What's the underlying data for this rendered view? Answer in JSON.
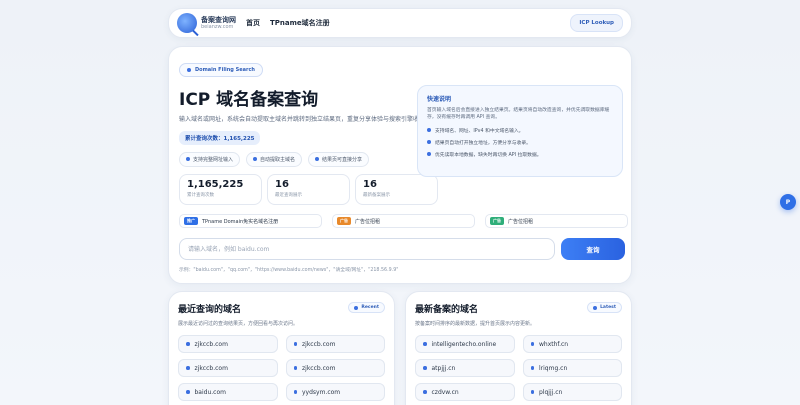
{
  "header": {
    "logo_name": "备案查询网",
    "logo_domain": "beianzw.com",
    "nav": [
      "首页",
      "TPname域名注册"
    ],
    "icp_button": "ICP Lookup"
  },
  "hero": {
    "pill": "Domain Filing Search",
    "title": "ICP 域名备案查询",
    "description": "输入域名或网址，系统会自动提取主域名并跳转到独立结果页，重复分享体验与搜索引擎收录。",
    "count_badge": "累计查询次数：1,165,225",
    "features": [
      "支持完整网址输入",
      "自动提取主域名",
      "结果页可直接分享"
    ],
    "stats": [
      {
        "value": "1,165,225",
        "label": "累计查询次数"
      },
      {
        "value": "16",
        "label": "最近查询展示"
      },
      {
        "value": "16",
        "label": "最新备案展示"
      }
    ],
    "quick": {
      "title": "快速说明",
      "description": "首页输入域名后会直接进入独立结果页。结果页将自动改造查询，并优先调取数据库缓存，没有缓存时再调用 API 查询。",
      "items": [
        "支持域名、网址、IPv4 和中文域名输入。",
        "结果页自动打开独立地址，方便分享与收录。",
        "优先读取本地数据，缺失时再切换 API 拉取数据。"
      ]
    },
    "links": [
      {
        "tag": "推广",
        "text": "TPname Domain免实名域名注册",
        "color": "#2f6fe6"
      },
      {
        "tag": "广告",
        "text": "广告位招租",
        "color": "#e8892b"
      },
      {
        "tag": "广告",
        "text": "广告位招租",
        "color": "#2fae7a"
      }
    ],
    "search": {
      "placeholder": "请输入域名，例如 baidu.com",
      "button": "查询"
    },
    "examples": "示例：\"baidu.com\"，\"qq.com\"，\"https://www.baidu.com/news\"，\"请全域/网址\"，\"218.56.9.9\""
  },
  "recent": {
    "title": "最近查询的域名",
    "description": "展示最近访问过的查询结果页，方便回看与再次访问。",
    "badge": "Recent",
    "items": [
      "zjkccb.com",
      "zjkccb.com",
      "zjkccb.com",
      "zjkccb.com",
      "baidu.com",
      "yydsym.com"
    ]
  },
  "latest": {
    "title": "最新备案的域名",
    "description": "按备案时间排序的最新数据，提升首页展示内容更新。",
    "badge": "Latest",
    "items": [
      "intelligentecho.online",
      "whxthf.cn",
      "atpjjj.cn",
      "lriqmg.cn",
      "czdvw.cn",
      "plqjjj.cn"
    ]
  },
  "float_button": "P"
}
